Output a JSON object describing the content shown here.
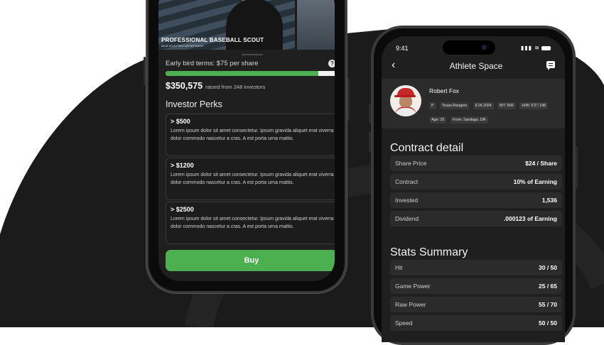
{
  "phone_left": {
    "video": {
      "caption": "PROFESSIONAL BASEBALL SCOUT",
      "subcaption": "MILB SCOUTING DEPARTMENT"
    },
    "terms_text": "Early bird terms: $75 per share",
    "help_icon": "question-circle-icon",
    "funding_progress": 0.89,
    "raised_amount": "$350,575",
    "raised_sub": "raised from 248 investors",
    "perks_title": "Investor Perks",
    "perks": [
      {
        "tier": "> $500",
        "description": "Lorem ipsum dolor sit amet consectetur. Ipsum gravida aliquet erat viverra dolor commodo nascetur a cras. A est porta urna mattis."
      },
      {
        "tier": "> $1200",
        "description": "Lorem ipsum dolor sit amet consectetur. Ipsum gravida aliquet erat viverra dolor commodo nascetur a cras. A est porta urna mattis."
      },
      {
        "tier": "> $2500",
        "description": "Lorem ipsum dolor sit amet consectetur. Ipsum gravida aliquet erat viverra dolor commodo nascetur a cras. A est porta urna mattis."
      }
    ],
    "buy_label": "Buy"
  },
  "phone_right": {
    "status": {
      "time": "9:41",
      "icons": "signal-wifi-battery-icons"
    },
    "nav": {
      "title": "Athlete Space",
      "back_icon": "chevron-left-icon",
      "chat_icon": "chat-bubble-icon"
    },
    "player": {
      "name": "Robert Fox",
      "tags": [
        "P",
        "Texas Rangers",
        "ETA 2024",
        "B/T: R/R",
        "H/W: 6'2\"/ 198",
        "Age: 25",
        "From: Santiago, DR"
      ]
    },
    "contract": {
      "title": "Contract detail",
      "rows": [
        {
          "label": "Share Price",
          "value": "$24 / Share"
        },
        {
          "label": "Contract",
          "value": "10% of Earning"
        },
        {
          "label": "Invested",
          "value": "1,536"
        },
        {
          "label": "Dividend",
          "value": ".000123 of Earning"
        }
      ]
    },
    "stats": {
      "title": "Stats Summary",
      "rows": [
        {
          "label": "Hit",
          "value": "30 / 50"
        },
        {
          "label": "Game Power",
          "value": "25 / 65"
        },
        {
          "label": "Raw Power",
          "value": "55 / 70"
        },
        {
          "label": "Speed",
          "value": "50 / 50"
        }
      ]
    }
  },
  "colors": {
    "accent": "#4caf50",
    "background": "#1f1f1f",
    "card": "#2b2b2b"
  }
}
